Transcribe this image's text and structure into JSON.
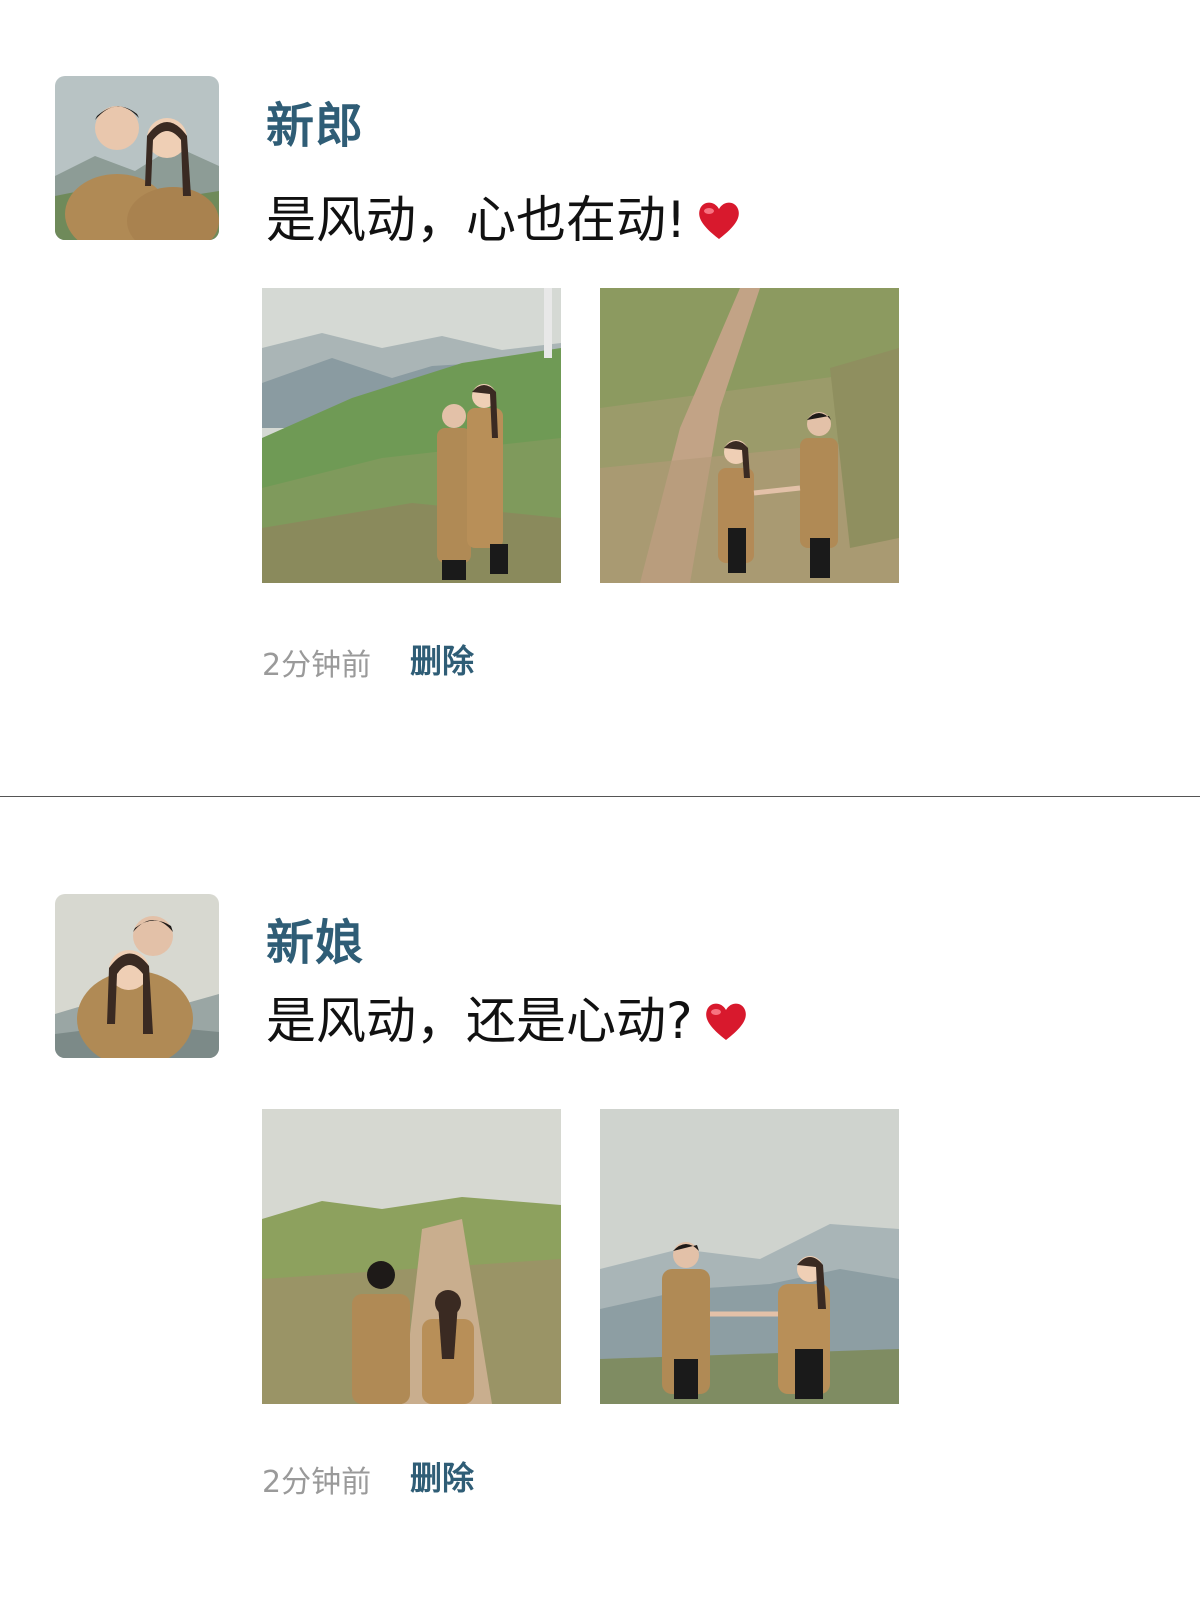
{
  "posts": [
    {
      "username": "新郎",
      "message": "是风动，心也在动!",
      "emoji": "heart-icon",
      "time": "2分钟前",
      "delete_label": "删除"
    },
    {
      "username": "新娘",
      "message": "是风动，还是心动?",
      "emoji": "heart-icon",
      "time": "2分钟前",
      "delete_label": "删除"
    }
  ],
  "colors": {
    "name": "#2f5d76",
    "link": "#2f5d76",
    "meta": "#9a9a9a",
    "text": "#111111",
    "divider": "#555555",
    "heart": "#d8192d"
  }
}
